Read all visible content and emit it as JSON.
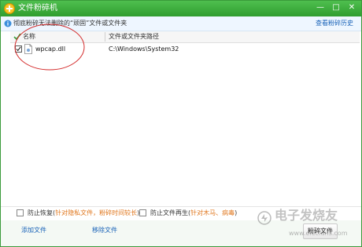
{
  "window": {
    "title": "文件粉碎机",
    "controls": {
      "minimize": "—",
      "maximize": "□",
      "close": "✕"
    }
  },
  "infobar": {
    "text": "彻底粉碎无法删除的“顽固”文件或文件夹",
    "history_link": "查看粉碎历史"
  },
  "table": {
    "columns": {
      "name": "名称",
      "path": "文件或文件夹路径"
    },
    "rows": [
      {
        "checked": true,
        "name": "wpcap.dll",
        "path": "C:\\Windows\\System32"
      }
    ]
  },
  "options": {
    "prevent_recovery": {
      "label": "防止恢复",
      "note_open": "(",
      "note": "针对隐私文件，粉碎时间较长",
      "note_close": ")"
    },
    "prevent_regen": {
      "label": "防止文件再生",
      "note_open": "(",
      "note": "针对木马、病毒",
      "note_close": ")"
    }
  },
  "bottom": {
    "add_file": "添加文件",
    "remove_file": "移除文件",
    "shred_button": "粉碎文件"
  },
  "watermark": {
    "main": "电子发烧友",
    "url": "www.elecfans.com"
  },
  "colors": {
    "title_green": "#2f9d2f",
    "link_blue": "#1a63b8",
    "annotation_red": "#d42a2a",
    "note_orange": "#e0771e"
  }
}
